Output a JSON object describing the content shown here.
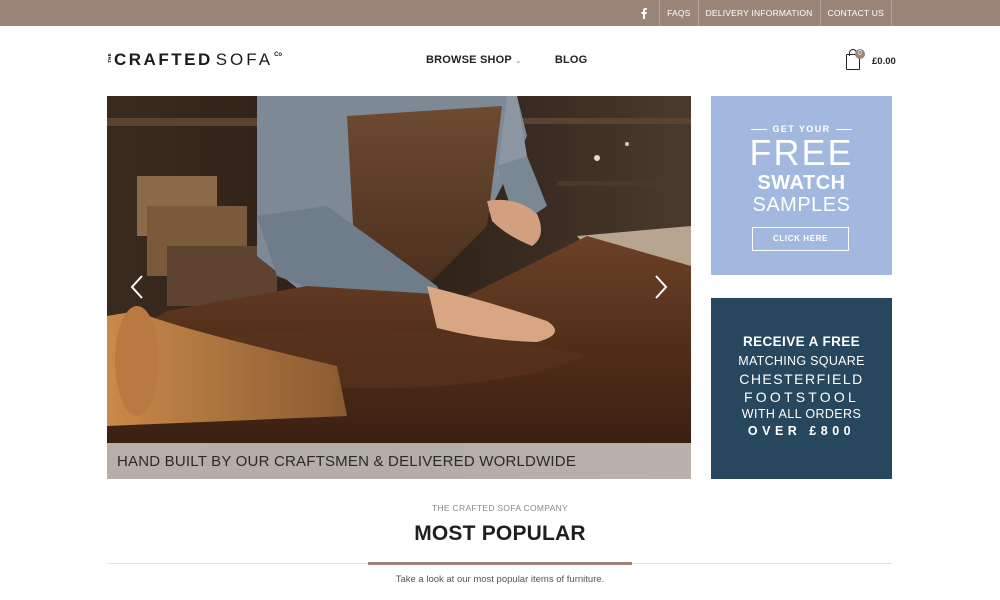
{
  "topbar": {
    "social_icon": "facebook-icon",
    "links": [
      "FAQS",
      "DELIVERY INFORMATION",
      "CONTACT US"
    ]
  },
  "header": {
    "logo": {
      "the": "THE",
      "crafted": "CRAFTED",
      "sofa": "SOFA",
      "co": "Co"
    },
    "nav": {
      "browse_shop": "BROWSE SHOP",
      "blog": "BLOG"
    },
    "cart": {
      "count": "0",
      "total": "£0.00",
      "icon": "shopping-bag-icon"
    }
  },
  "hero": {
    "caption": "HAND BUILT BY OUR CRAFTSMEN & DELIVERED WORLDWIDE",
    "prev_icon": "chevron-left-icon",
    "next_icon": "chevron-right-icon"
  },
  "swatch_promo": {
    "get_your": "GET YOUR",
    "free": "FREE",
    "swatch": "SWATCH",
    "samples": "SAMPLES",
    "button": "CLICK HERE",
    "bg_color": "#a2b8df"
  },
  "footstool_promo": {
    "line1": "RECEIVE A FREE",
    "line2": "MATCHING SQUARE",
    "line3": "CHESTERFIELD",
    "line4": "FOOTSTOOL",
    "line5": "WITH ALL ORDERS",
    "line6": "OVER £800",
    "bg_color": "#27475e"
  },
  "section": {
    "kicker": "THE CRAFTED SOFA COMPANY",
    "title": "MOST POPULAR",
    "subtitle": "Take a look at our most popular items of furniture."
  },
  "colors": {
    "accent": "#9b8579",
    "topbar": "#9b8579"
  }
}
